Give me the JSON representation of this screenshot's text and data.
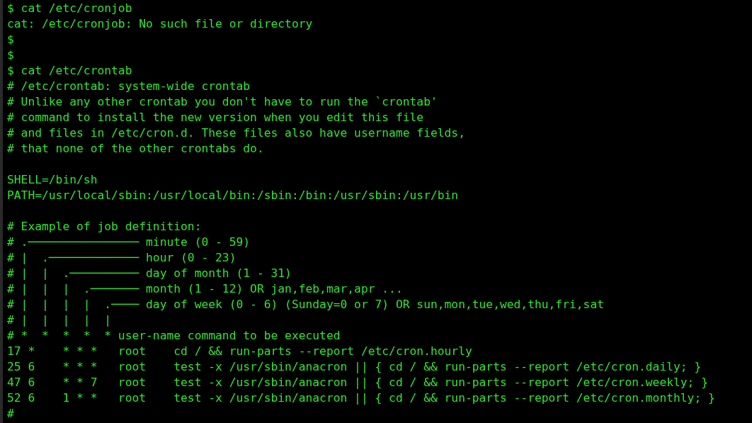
{
  "terminal": {
    "lines": [
      {
        "kind": "text",
        "text": "$ cat /etc/cronjob"
      },
      {
        "kind": "text",
        "text": "cat: /etc/cronjob: No such file or directory"
      },
      {
        "kind": "text",
        "text": "$"
      },
      {
        "kind": "text",
        "text": "$"
      },
      {
        "kind": "text",
        "text": "$ cat /etc/crontab"
      },
      {
        "kind": "text",
        "text": "# /etc/crontab: system-wide crontab"
      },
      {
        "kind": "text",
        "text": "# Unlike any other crontab you don't have to run the `crontab'"
      },
      {
        "kind": "text",
        "text": "# command to install the new version when you edit this file"
      },
      {
        "kind": "text",
        "text": "# and files in /etc/cron.d. These files also have username fields,"
      },
      {
        "kind": "text",
        "text": "# that none of the other crontabs do."
      },
      {
        "kind": "blank"
      },
      {
        "kind": "text",
        "text": "SHELL=/bin/sh"
      },
      {
        "kind": "text",
        "text": "PATH=/usr/local/sbin:/usr/local/bin:/sbin:/bin:/usr/sbin:/usr/bin"
      },
      {
        "kind": "blank"
      },
      {
        "kind": "text",
        "text": "# Example of job definition:"
      },
      {
        "kind": "text",
        "text": "# .──────────────── minute (0 - 59)"
      },
      {
        "kind": "text",
        "text": "# |  .───────────── hour (0 - 23)"
      },
      {
        "kind": "text",
        "text": "# |  |  .────────── day of month (1 - 31)"
      },
      {
        "kind": "text",
        "text": "# |  |  |  .─────── month (1 - 12) OR jan,feb,mar,apr ..."
      },
      {
        "kind": "text",
        "text": "# |  |  |  |  .──── day of week (0 - 6) (Sunday=0 or 7) OR sun,mon,tue,wed,thu,fri,sat"
      },
      {
        "kind": "text",
        "text": "# |  |  |  |  |"
      },
      {
        "kind": "text",
        "text": "# *  *  *  *  * user-name command to be executed"
      },
      {
        "kind": "text",
        "text": "17 *    * * *   root    cd / && run-parts --report /etc/cron.hourly"
      },
      {
        "kind": "text",
        "text": "25 6    * * *   root    test -x /usr/sbin/anacron || { cd / && run-parts --report /etc/cron.daily; }"
      },
      {
        "kind": "text",
        "text": "47 6    * * 7   root    test -x /usr/sbin/anacron || { cd / && run-parts --report /etc/cron.weekly; }"
      },
      {
        "kind": "text",
        "text": "52 6    1 * *   root    test -x /usr/sbin/anacron || { cd / && run-parts --report /etc/cron.monthly; }"
      },
      {
        "kind": "text",
        "text": "#"
      }
    ]
  }
}
